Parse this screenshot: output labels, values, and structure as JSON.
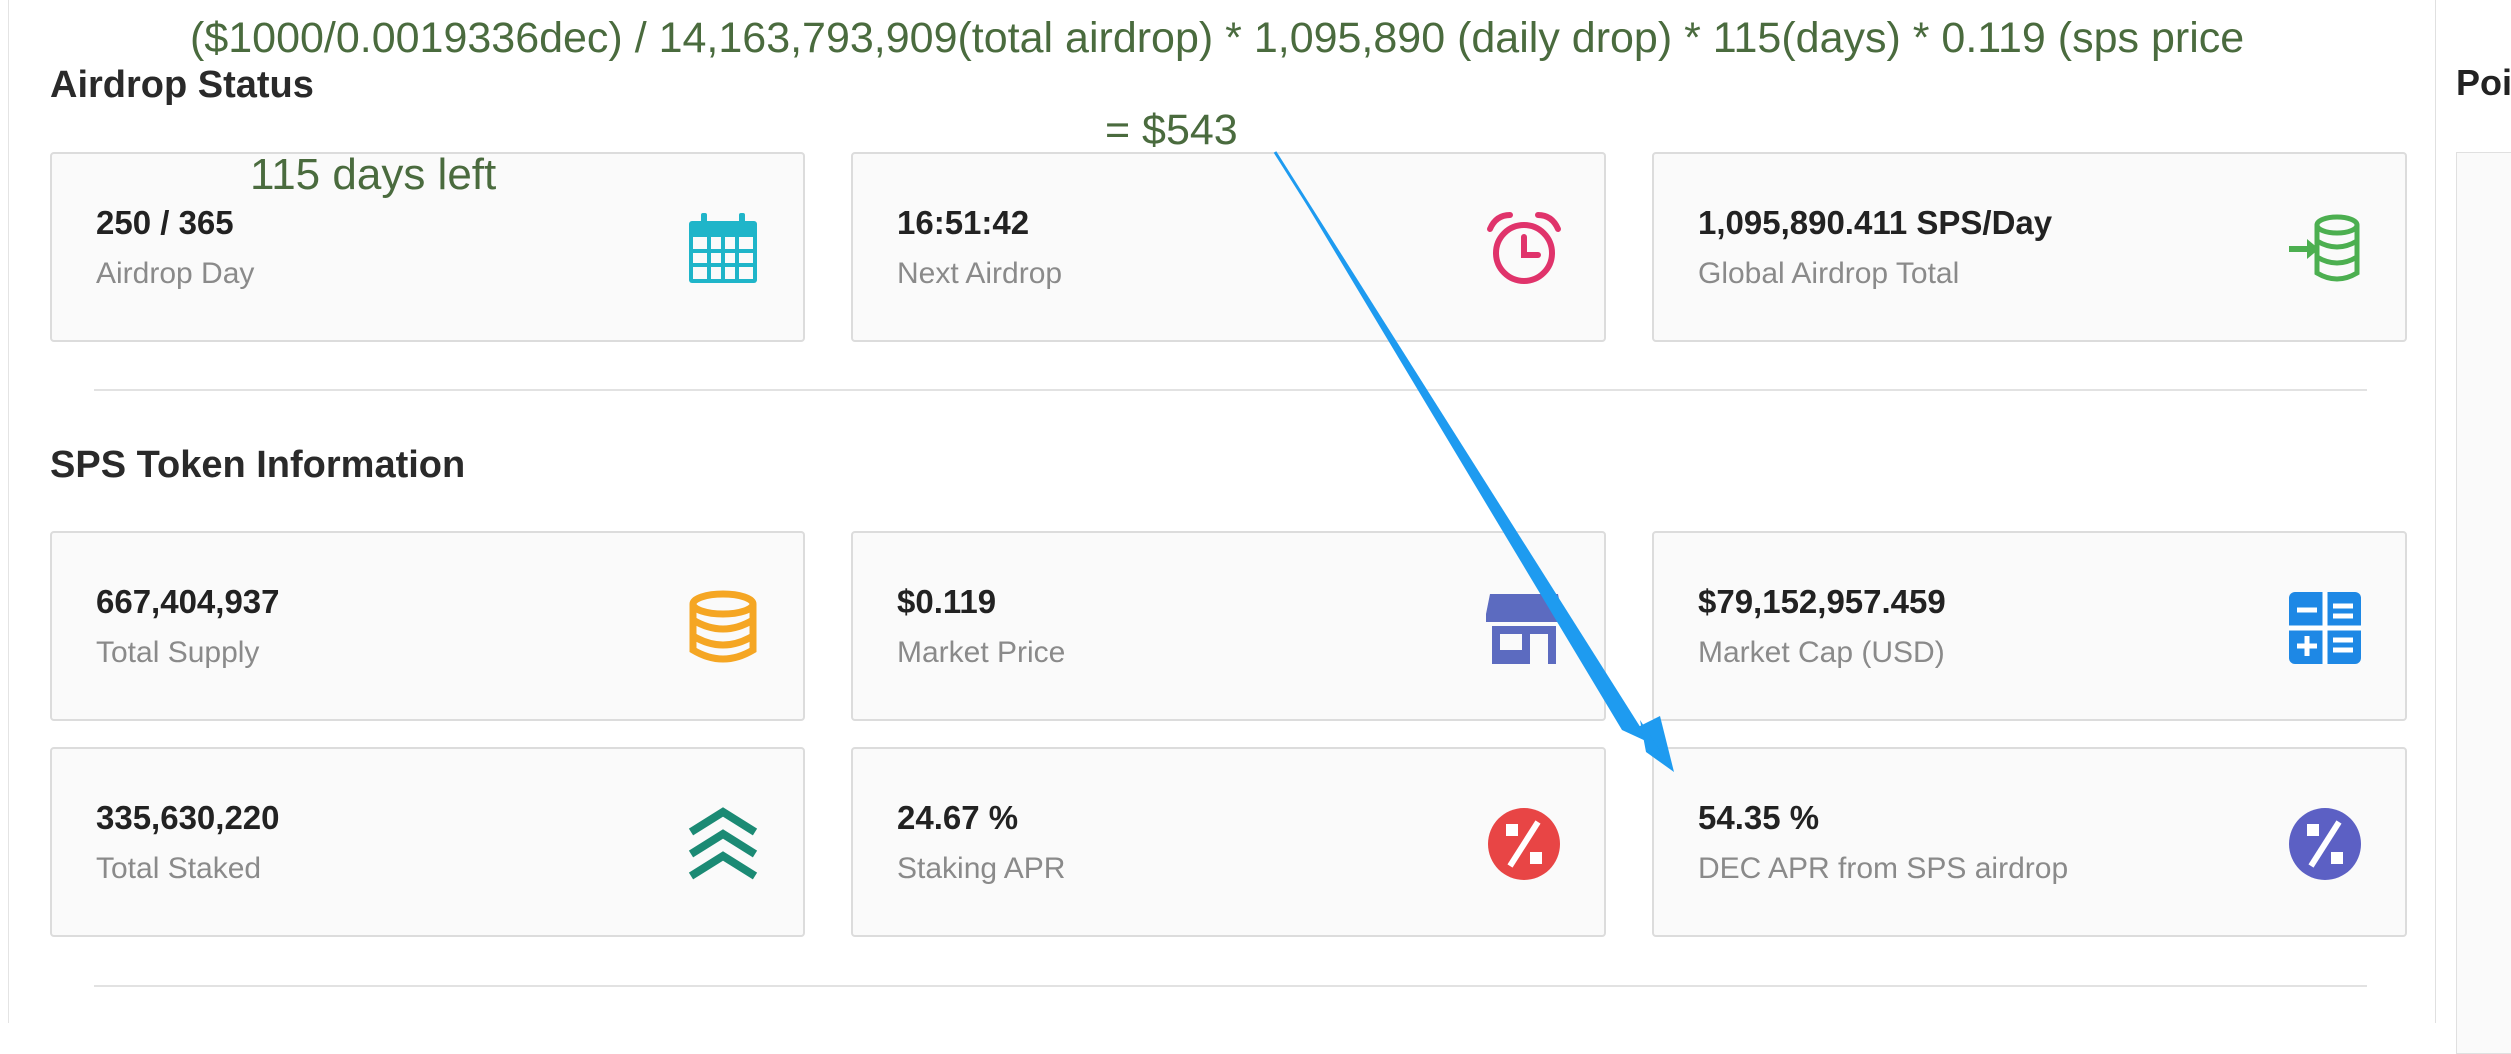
{
  "annotations": {
    "formula": "($1000/0.0019336dec) / 14,163,793,909(total airdrop) *  1,095,890 (daily drop) * 115(days) * 0.119 (sps price",
    "result": "= $543",
    "days_left": "115 days left",
    "annotation_color": "#4a6b3e",
    "arrow_color": "#1e9bf0"
  },
  "airdrop_status": {
    "title": "Airdrop Status",
    "cards": [
      {
        "value": "250 / 365",
        "label": "Airdrop Day",
        "icon": "calendar-icon",
        "color": "#1fb5c9"
      },
      {
        "value": "16:51:42",
        "label": "Next Airdrop",
        "icon": "alarm-clock-icon",
        "color": "#e0336b"
      },
      {
        "value": "1,095,890.411 SPS/Day",
        "label": "Global Airdrop Total",
        "icon": "database-import-icon",
        "color": "#4caf50"
      }
    ]
  },
  "token_info": {
    "title": "SPS Token Information",
    "cards": [
      {
        "value": "667,404,937",
        "label": "Total Supply",
        "icon": "coin-stack-icon",
        "color": "#f5a623"
      },
      {
        "value": "$0.119",
        "label": "Market Price",
        "icon": "storefront-icon",
        "color": "#5c6bc0"
      },
      {
        "value": "$79,152,957.459",
        "label": "Market Cap (USD)",
        "icon": "calculator-icon",
        "color": "#1e88e5"
      },
      {
        "value": "335,630,220",
        "label": "Total Staked",
        "icon": "chevrons-up-icon",
        "color": "#1b8a74"
      },
      {
        "value": "24.67 %",
        "label": "Staking APR",
        "icon": "percent-icon",
        "color": "#e84545"
      },
      {
        "value": "54.35 %",
        "label": "DEC APR from SPS airdrop",
        "icon": "percent-icon",
        "color": "#5c60c4"
      }
    ]
  },
  "right_panel": {
    "title": "Poi"
  }
}
